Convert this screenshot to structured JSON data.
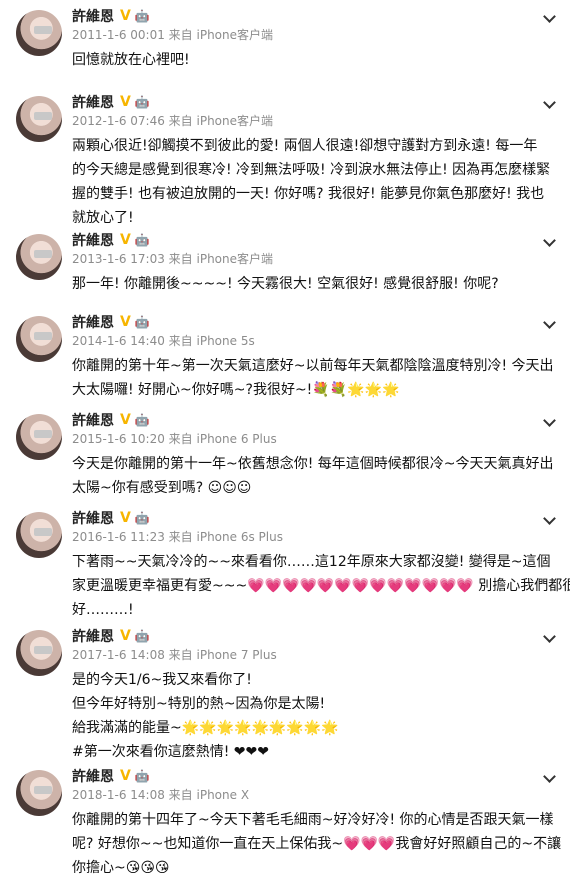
{
  "user": {
    "name": "許維恩",
    "verified_badge": "V",
    "bot_icon": "robot-icon"
  },
  "posts": [
    {
      "time": "2011-1-6 00:01 来自 iPhone客户端",
      "lines": [
        "回憶就放在心裡吧!"
      ]
    },
    {
      "time": "2012-1-6 07:46 来自 iPhone客户端",
      "lines": [
        "兩顆心很近!卻觸摸不到彼此的愛! 兩個人很遠!卻想守護對方到永遠! 每一年",
        "的今天總是感覺到很寒冷! 冷到無法呼吸! 冷到淚水無法停止! 因為再怎麼樣緊",
        "握的雙手! 也有被迫放開的一天! 你好嗎? 我很好! 能夢見你氣色那麼好! 我也",
        "就放心了!"
      ]
    },
    {
      "time": "2013-1-6 17:03 来自 iPhone客户端",
      "lines": [
        "那一年! 你離開後~~~~! 今天霧很大! 空氣很好! 感覺很舒服! 你呢?"
      ]
    },
    {
      "time": "2014-1-6 14:40 来自 iPhone 5s",
      "lines": [
        "你離開的第十年~第一次天氣這麼好~以前每年天氣都陰陰溫度特別冷! 今天出",
        "大太陽囉! 好開心~你好嗎~?我很好~!💐💐🌟🌟🌟"
      ]
    },
    {
      "time": "2015-1-6 10:20 来自 iPhone 6 Plus",
      "lines": [
        "今天是你離開的第十一年~依舊想念你! 每年這個時候都很冷~今天天氣真好出",
        "太陽~你有感受到嗎? ☺☺☺"
      ]
    },
    {
      "time": "2016-1-6 11:23 来自 iPhone 6s Plus",
      "lines": [
        "下著雨~~天氣冷冷的~~來看看你……這12年原來大家都沒變! 變得是~這個",
        "家更溫暖更幸福更有愛~~~💗💗💗💗💗💗💗💗💗💗💗💗💗 別擔心我們都很",
        "好………!"
      ]
    },
    {
      "time": "2017-1-6 14:08 来自 iPhone 7 Plus",
      "lines": [
        "是的今天1/6~我又來看你了!",
        "但今年好特別~特別的熱~因為你是太陽!",
        "給我滿滿的能量~🌟🌟🌟🌟🌟🌟🌟🌟🌟",
        "#第一次來看你這麼熱情! ❤❤❤"
      ]
    },
    {
      "time": "2018-1-6 14:08 来自 iPhone X",
      "lines": [
        "你離開的第十四年了~今天下著毛毛細雨~好冷好冷! 你的心情是否跟天氣一樣",
        "呢? 好想你~~也知道你一直在天上保佑我~💗💗💗我會好好照顧自己的~不讓",
        "你擔心~😘😘😘"
      ]
    }
  ]
}
